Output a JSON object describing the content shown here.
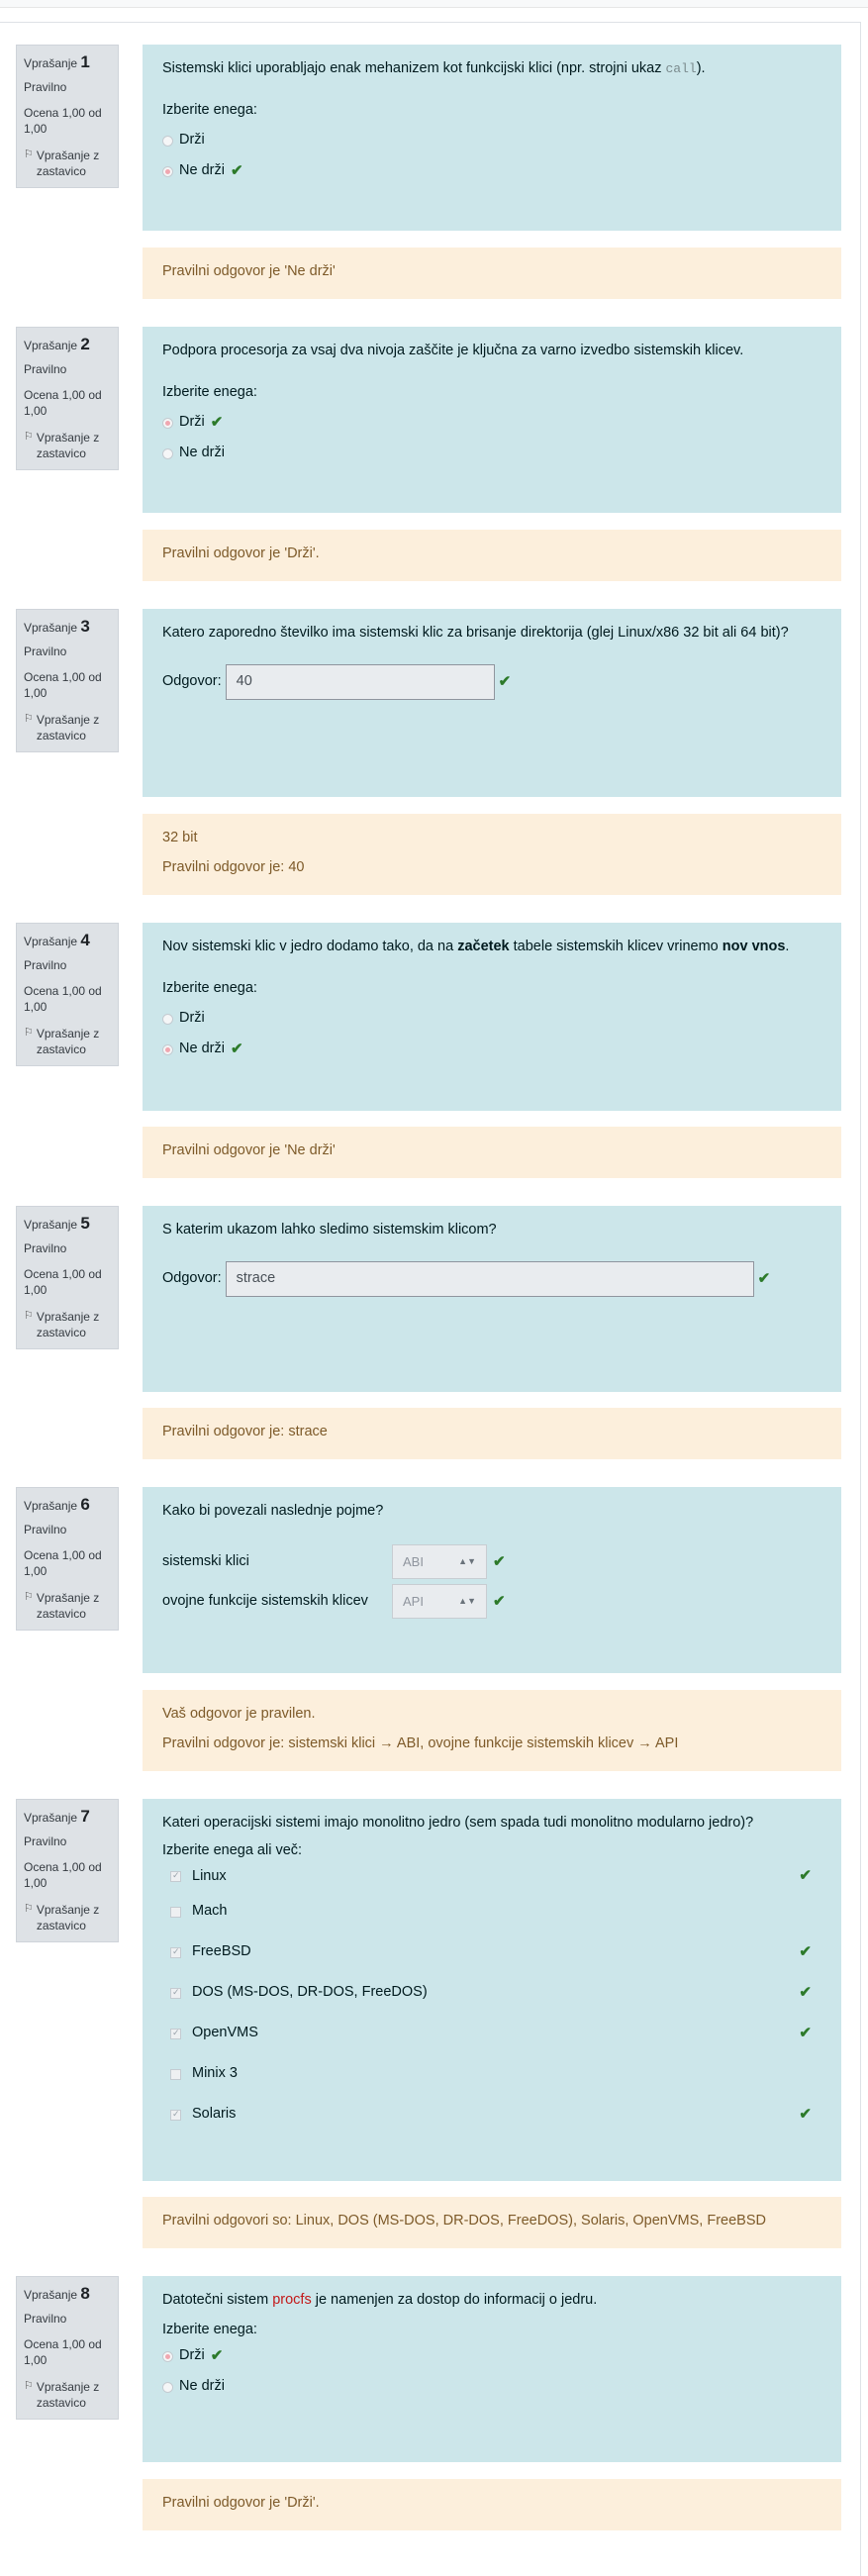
{
  "labels": {
    "question_prefix": "Vprašanje",
    "state": "Pravilno",
    "grade": "Ocena 1,00 od 1,00",
    "flag": "Vprašanje z zastavico",
    "choose_one": "Izberite enega:",
    "choose_many": "Izberite enega ali več:",
    "answer": "Odgovor:"
  },
  "q1": {
    "number": "1",
    "text_before": "Sistemski klici uporabljajo enak mehanizem kot funkcijski klici (npr. strojni ukaz ",
    "text_code": "call",
    "text_after": ").",
    "options": [
      "Drži",
      "Ne drži"
    ],
    "selected": 1,
    "feedback": "Pravilni odgovor je 'Ne drži'"
  },
  "q2": {
    "number": "2",
    "text": "Podpora procesorja za vsaj dva nivoja zaščite je ključna za varno izvedbo sistemskih klicev.",
    "options": [
      "Drži",
      "Ne drži"
    ],
    "selected": 0,
    "feedback": "Pravilni odgovor je 'Drži'."
  },
  "q3": {
    "number": "3",
    "text": "Katero zaporedno številko ima sistemski klic za brisanje direktorija (glej Linux/x86 32 bit ali 64 bit)?",
    "answer_value": "40",
    "feedback_note": "32 bit",
    "feedback": "Pravilni odgovor je: 40"
  },
  "q4": {
    "number": "4",
    "text_a": "Nov sistemski klic v jedro dodamo tako, da na ",
    "text_b": "začetek",
    "text_c": " tabele sistemskih klicev vrinemo ",
    "text_d": "nov vnos",
    "text_e": ".",
    "options": [
      "Drži",
      "Ne drži"
    ],
    "selected": 1,
    "feedback": "Pravilni odgovor je 'Ne drži'"
  },
  "q5": {
    "number": "5",
    "text": "S katerim ukazom lahko sledimo sistemskim klicom?",
    "answer_value": "strace",
    "feedback": "Pravilni odgovor je: strace"
  },
  "q6": {
    "number": "6",
    "text": "Kako bi povezali naslednje pojme?",
    "rows": [
      {
        "label": "sistemski klici",
        "value": "ABI"
      },
      {
        "label": "ovojne funkcije sistemskih klicev",
        "value": "API"
      }
    ],
    "feedback_note": "Vaš odgovor je pravilen.",
    "feedback": "Pravilni odgovor je: sistemski klici → ABI, ovojne funkcije sistemskih klicev → API"
  },
  "q7": {
    "number": "7",
    "text": "Kateri operacijski sistemi imajo monolitno jedro (sem spada tudi monolitno modularno jedro)?",
    "options": [
      {
        "label": "Linux",
        "checked": true
      },
      {
        "label": "Mach",
        "checked": false
      },
      {
        "label": "FreeBSD",
        "checked": true
      },
      {
        "label": "DOS (MS-DOS, DR-DOS, FreeDOS)",
        "checked": true
      },
      {
        "label": "OpenVMS",
        "checked": true
      },
      {
        "label": "Minix 3",
        "checked": false
      },
      {
        "label": "Solaris",
        "checked": true
      }
    ],
    "feedback": "Pravilni odgovori so: Linux, DOS (MS-DOS, DR-DOS, FreeDOS), Solaris, OpenVMS, FreeBSD"
  },
  "q8": {
    "number": "8",
    "text_a": "Datotečni sistem ",
    "text_b": "procfs",
    "text_c": " je namenjen za dostop do informacij o jedru.",
    "options": [
      "Drži",
      "Ne drži"
    ],
    "selected": 0,
    "feedback": "Pravilni odgovor je 'Drži'."
  }
}
